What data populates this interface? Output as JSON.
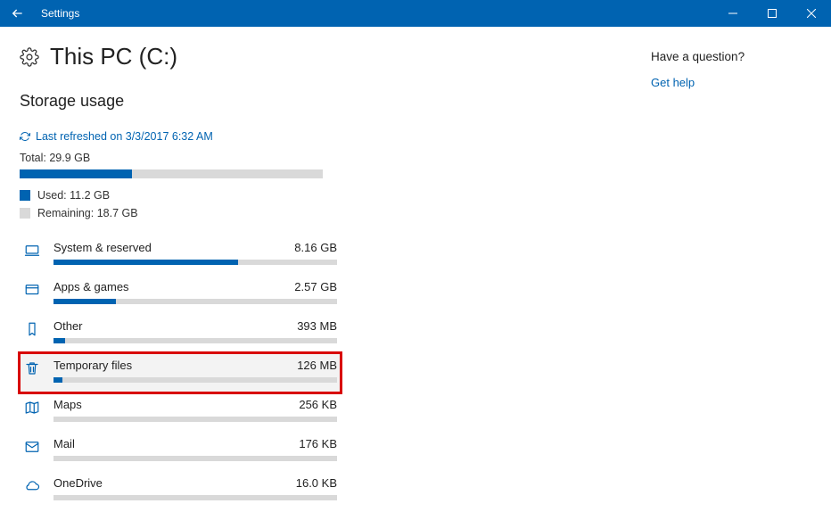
{
  "titlebar": {
    "title": "Settings"
  },
  "page": {
    "title": "This PC (C:)"
  },
  "section_title": "Storage usage",
  "refresh_text": "Last refreshed on 3/3/2017 6:32 AM",
  "total_label": "Total: 29.9 GB",
  "total_fill_pct": 37,
  "legend_used": "Used: 11.2 GB",
  "legend_remaining": "Remaining: 18.7 GB",
  "categories": [
    {
      "name": "System & reserved",
      "size": "8.16 GB",
      "icon": "computer",
      "pct": 65,
      "highlight": false
    },
    {
      "name": "Apps & games",
      "size": "2.57 GB",
      "icon": "apps",
      "pct": 22,
      "highlight": false
    },
    {
      "name": "Other",
      "size": "393 MB",
      "icon": "bookmark",
      "pct": 4,
      "highlight": false
    },
    {
      "name": "Temporary files",
      "size": "126 MB",
      "icon": "trash",
      "pct": 3,
      "highlight": true
    },
    {
      "name": "Maps",
      "size": "256 KB",
      "icon": "map",
      "pct": 0,
      "highlight": false
    },
    {
      "name": "Mail",
      "size": "176 KB",
      "icon": "mail",
      "pct": 0,
      "highlight": false
    },
    {
      "name": "OneDrive",
      "size": "16.0 KB",
      "icon": "cloud",
      "pct": 0,
      "highlight": false
    }
  ],
  "sidebar": {
    "question": "Have a question?",
    "help_link": "Get help"
  },
  "chart_data": {
    "type": "bar",
    "title": "Storage usage — This PC (C:)",
    "total_gb": 29.9,
    "used_gb": 11.2,
    "remaining_gb": 18.7,
    "series": [
      {
        "name": "System & reserved",
        "value_gb": 8.16
      },
      {
        "name": "Apps & games",
        "value_gb": 2.57
      },
      {
        "name": "Other",
        "value_gb": 0.393
      },
      {
        "name": "Temporary files",
        "value_gb": 0.126
      },
      {
        "name": "Maps",
        "value_gb": 0.000256
      },
      {
        "name": "Mail",
        "value_gb": 0.000176
      },
      {
        "name": "OneDrive",
        "value_gb": 1.6e-05
      }
    ]
  }
}
